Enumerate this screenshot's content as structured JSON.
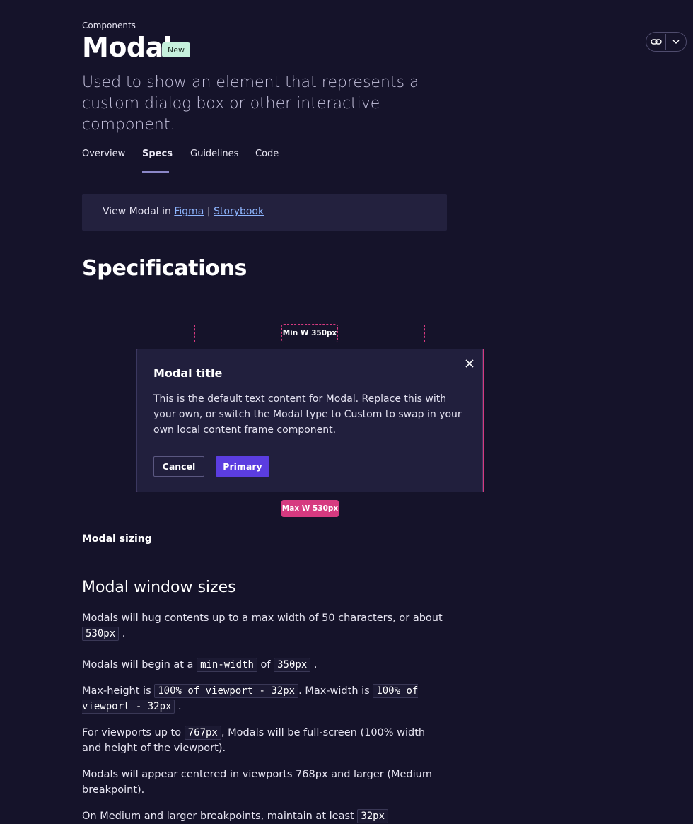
{
  "header": {
    "eyebrow": "Components",
    "title": "Modal",
    "badge": "New",
    "lead": "Used to show an element that represents a custom dialog box or other interactive component."
  },
  "tabs": [
    {
      "label": "Overview"
    },
    {
      "label": "Specs",
      "active": true
    },
    {
      "label": "Guidelines"
    },
    {
      "label": "Code"
    }
  ],
  "toolbar": {
    "link_icon": "link-icon",
    "menu_icon": "chevron-down-icon"
  },
  "callout": {
    "prefix": "View Modal in",
    "figma": "Figma",
    "separator": "|",
    "storybook": "Storybook"
  },
  "specs": {
    "heading": "Specifications",
    "min_label": "Min W 350px",
    "max_label": "Max W 530px",
    "caption": "Modal sizing"
  },
  "modal": {
    "title": "Modal title",
    "body": "This is the default text content for Modal. Replace this with your own, or switch the Modal type to Custom to swap in your own local content frame component.",
    "cancel": "Cancel",
    "primary": "Primary"
  },
  "sizes": {
    "heading": "Modal window sizes",
    "p1_text": "Modals will hug contents up to a max width of 50 characters, or about",
    "p1_code": "530px",
    "p2_text": "Modals will begin at a",
    "p2_code1": "min-width",
    "p2_mid": "of",
    "p2_code2": "350px",
    "p3_text1": "Max-height is",
    "p3_code1": "100% of viewport - 32px",
    "p3_text2": ". Max-width is",
    "p3_code2": "100% of viewport - 32px",
    "p4_text1": "For viewports up to",
    "p4_code": "767px",
    "p4_text2": ", Modals will be full-screen (100% width and height of the viewport).",
    "p5_text": "Modals will appear centered in viewports 768px and larger (Medium breakpoint).",
    "p6_text": "On Medium and larger breakpoints, maintain at least",
    "p6_code": "32px"
  },
  "colors": {
    "background": "#15132a",
    "accent": "#d63a80",
    "primary": "#5b3de0",
    "link": "#8fb6ff"
  }
}
